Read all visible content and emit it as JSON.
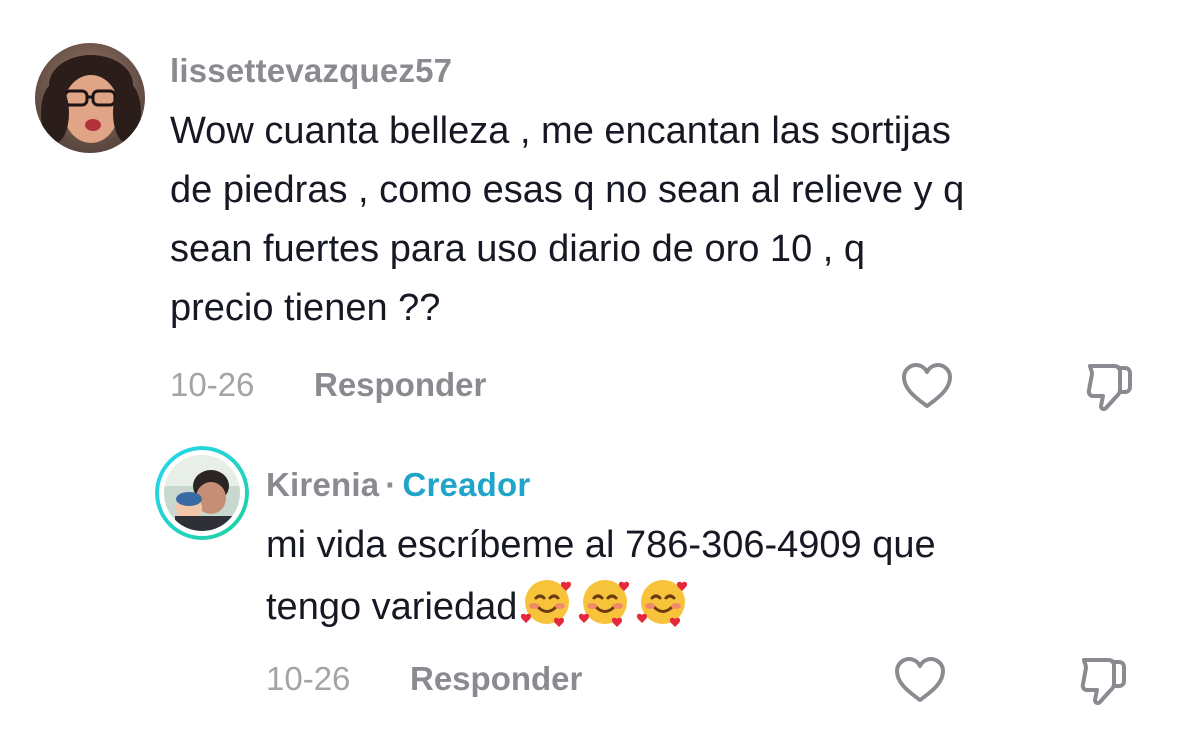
{
  "comment": {
    "username": "lissettevazquez57",
    "text_lines": [
      "Wow cuanta belleza , me encantan las sortijas",
      "de piedras , como esas q no sean al relieve y q",
      "sean fuertes para uso diario de oro 10 , q",
      "precio tienen ??"
    ],
    "date": "10-26",
    "reply_label": "Responder"
  },
  "reply": {
    "username": "Kirenia",
    "separator": "·",
    "badge": "Creador",
    "text_line1": "mi vida escríbeme al 786-306-4909 que",
    "text_line2": "tengo variedad",
    "date": "10-26",
    "reply_label": "Responder"
  },
  "icons": {
    "like": "heart-outline-icon",
    "dislike": "thumbs-down-outline-icon",
    "emoji": "smiling-face-with-hearts"
  },
  "colors": {
    "text": "#161823",
    "muted": "#8a8b91",
    "date": "#a3a4a8",
    "creator_accent": "#20a5c8",
    "story_ring_start": "#26d6f0",
    "story_ring_end": "#1fd1a0"
  }
}
